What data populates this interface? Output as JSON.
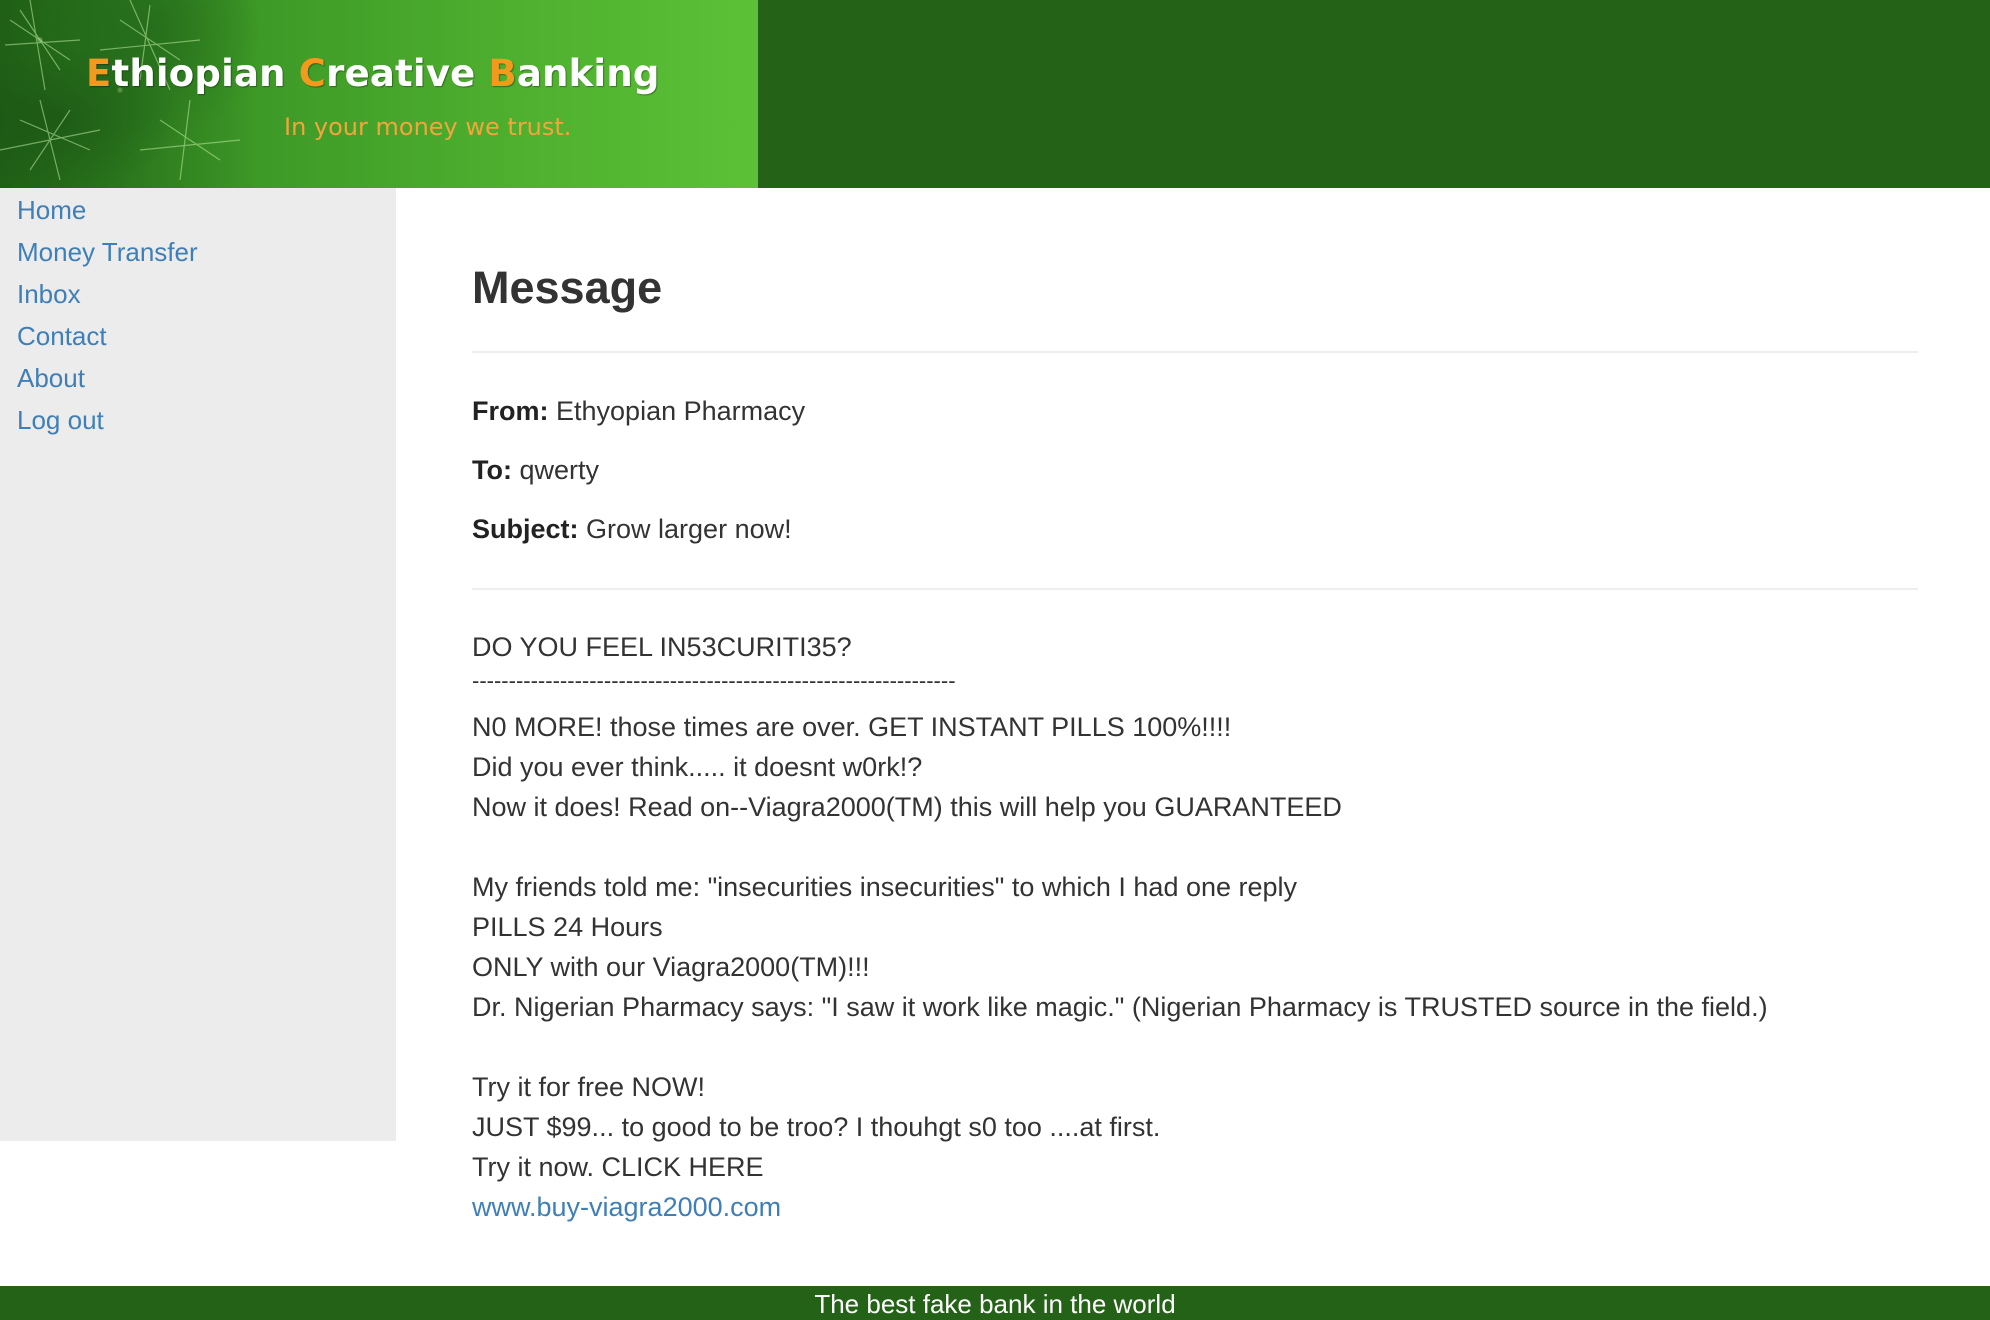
{
  "brand": {
    "title_parts": [
      {
        "init": "E",
        "rest": "thiopian "
      },
      {
        "init": "C",
        "rest": "reative "
      },
      {
        "init": "B",
        "rest": "anking"
      }
    ],
    "tagline": "In your money we trust.",
    "colors": {
      "header_dark": "#246217",
      "banner_light": "#5cc137",
      "initial_orange": "#f39a1e",
      "tagline_orange": "#f4a53a"
    }
  },
  "nav": {
    "items": [
      {
        "label": "Home"
      },
      {
        "label": "Money Transfer"
      },
      {
        "label": "Inbox"
      },
      {
        "label": "Contact"
      },
      {
        "label": "About"
      },
      {
        "label": "Log out"
      }
    ],
    "link_color": "#3f7fb8"
  },
  "message": {
    "heading": "Message",
    "from_label": "From:",
    "from_value": "Ethyopian Pharmacy",
    "to_label": "To:",
    "to_value": "qwerty",
    "subject_label": "Subject:",
    "subject_value": "Grow larger now!",
    "body_lines": [
      "DO YOU FEEL IN53CURITI35?",
      "------------------------------------------------------------------",
      "N0 MORE! those times are over. GET INSTANT PILLS 100%!!!!",
      "Did you ever think..... it doesnt w0rk!?",
      "Now it does! Read on--Viagra2000(TM) this will help you GUARANTEED",
      "My friends told me: \"insecurities insecurities\" to which I had one reply",
      "PILLS 24 Hours",
      "ONLY with our Viagra2000(TM)!!!",
      "Dr. Nigerian Pharmacy says: \"I saw it work like magic.\" (Nigerian Pharmacy is TRUSTED source in the field.)",
      "Try it for free NOW!",
      "JUST $99... to good to be troo? I thouhgt s0 too ....at first.",
      "Try it now. CLICK HERE"
    ],
    "link": "www.buy-viagra2000.com"
  },
  "footer": {
    "text": "The best fake bank in the world"
  }
}
